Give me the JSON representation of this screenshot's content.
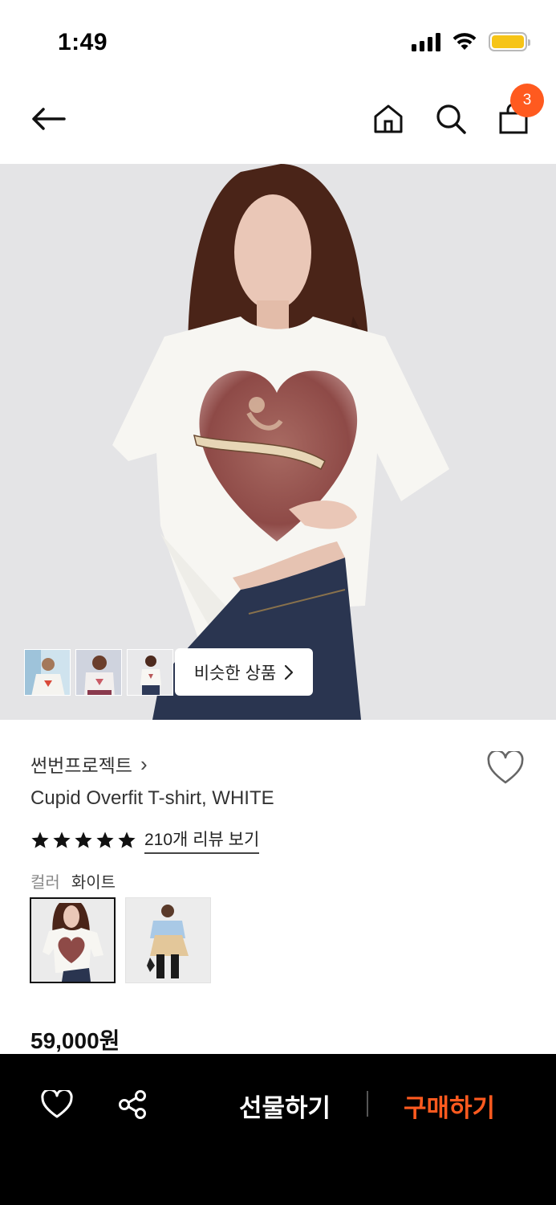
{
  "status_bar": {
    "time": "1:49",
    "signal_icon": "cellular-signal-icon",
    "wifi_icon": "wifi-icon",
    "battery_icon": "battery-icon",
    "battery_color": "#f6c417"
  },
  "nav": {
    "back_icon": "arrow-left-icon",
    "home_icon": "home-icon",
    "search_icon": "search-icon",
    "bag_icon": "shopping-bag-icon",
    "cart_count": "3",
    "badge_color": "#ff5a1f"
  },
  "gallery": {
    "thumbnails": [
      "thumb-1",
      "thumb-2",
      "thumb-3"
    ],
    "similar_label": "비슷한 상품",
    "similar_chevron": "chevron-right-icon"
  },
  "product": {
    "brand": "썬번프로젝트",
    "brand_chevron": "›",
    "title": "Cupid Overfit T-shirt, WHITE",
    "star_count": 5,
    "review_link": "210개 리뷰 보기",
    "color_label": "컬러",
    "color_value": "화이트",
    "swatches": [
      "white-heart-tee",
      "blue-tee"
    ],
    "price": "59,000원"
  },
  "bottom_bar": {
    "wish_icon": "heart-icon",
    "share_icon": "share-icon",
    "gift_label": "선물하기",
    "buy_label": "구매하기",
    "accent_color": "#ff5a1f"
  }
}
